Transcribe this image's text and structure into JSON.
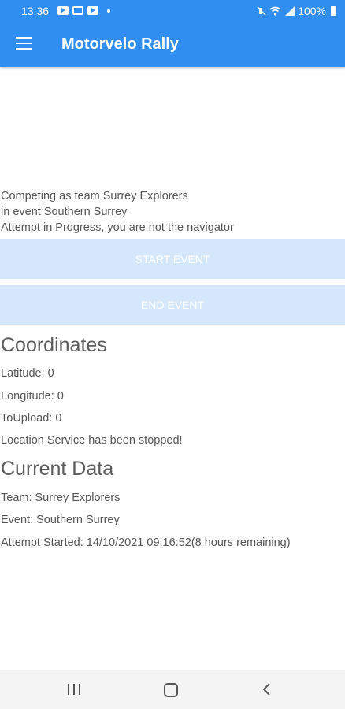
{
  "status_bar": {
    "time": "13:36",
    "battery": "100%"
  },
  "app_bar": {
    "title": "Motorvelo Rally"
  },
  "info": {
    "team_line": "Competing as team Surrey Explorers",
    "event_line": "in event Southern Surrey",
    "attempt_line": "Attempt in Progress, you are not the navigator"
  },
  "buttons": {
    "start": "START EVENT",
    "end": "END EVENT"
  },
  "coordinates": {
    "title": "Coordinates",
    "latitude": "Latitude: 0",
    "longitude": "Longitude: 0",
    "to_upload": "ToUpload: 0",
    "service_status": "Location Service has been stopped!"
  },
  "current_data": {
    "title": "Current Data",
    "team": "Team: Surrey Explorers",
    "event": "Event: Southern Surrey",
    "attempt": "Attempt Started: 14/10/2021 09:16:52(8 hours remaining)"
  },
  "colors": {
    "primary": "#2f8ef0",
    "button_disabled": "#d4e7fb",
    "text": "#555555"
  },
  "icons": [
    "menu-icon",
    "youtube-icon",
    "document-icon",
    "mute-icon",
    "wifi-icon",
    "signal-icon",
    "battery-icon",
    "recent-apps-icon",
    "home-icon",
    "back-icon"
  ]
}
